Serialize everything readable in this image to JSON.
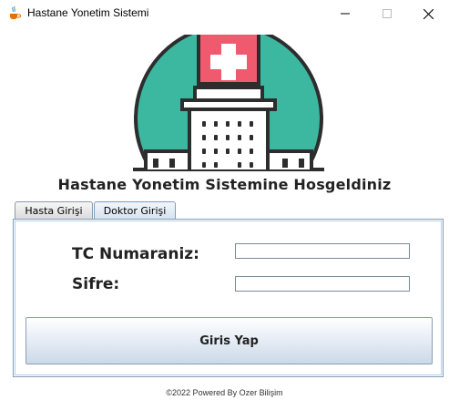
{
  "window": {
    "title": "Hastane Yonetim Sistemi",
    "icons": [
      "java-cup-icon",
      "minimize-icon",
      "maximize-icon",
      "close-icon"
    ]
  },
  "header": {
    "welcome": "Hastane Yonetim Sistemine Hosgeldiniz"
  },
  "tabs": [
    {
      "label": "Hasta Girişi",
      "selected": false
    },
    {
      "label": "Doktor Girişi",
      "selected": true
    }
  ],
  "form": {
    "tc_label": "TC Numaraniz:",
    "tc_value": "",
    "password_label": "Sifre:",
    "password_value": "",
    "login_button": "Giris Yap"
  },
  "footer": {
    "text": "©2022 Powered By Ozer Bilişim"
  },
  "colors": {
    "logo_circle": "#3cb8a0",
    "logo_red": "#ef5a6f",
    "logo_dark": "#2d2d2d",
    "panel_border": "#7f9db9"
  }
}
